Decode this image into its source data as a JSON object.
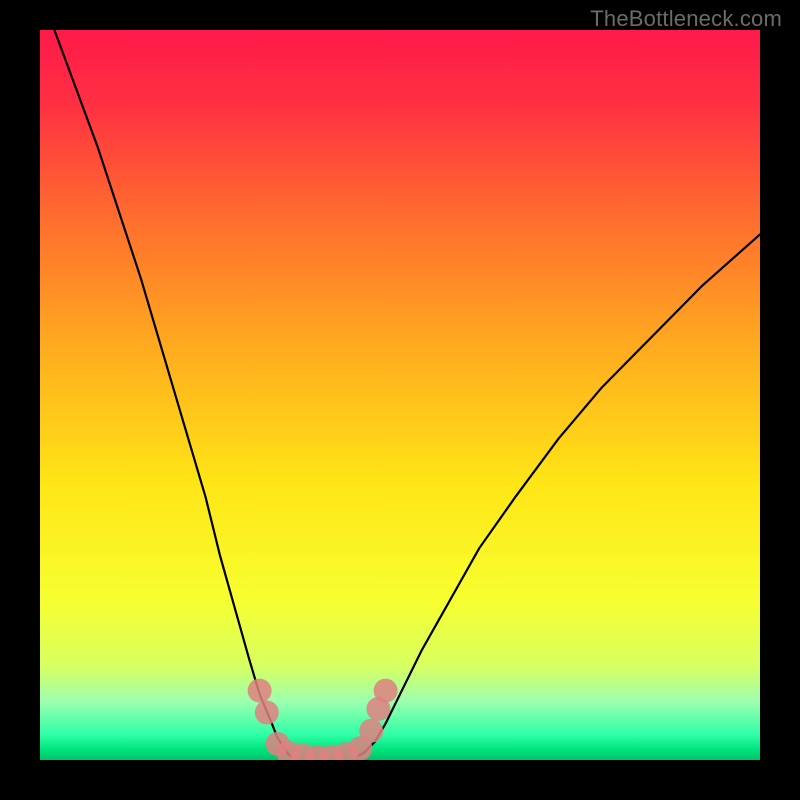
{
  "watermark": "TheBottleneck.com",
  "chart_data": {
    "type": "line",
    "title": "",
    "xlabel": "",
    "ylabel": "",
    "xlim": [
      0,
      100
    ],
    "ylim": [
      0,
      100
    ],
    "grid": false,
    "legend": false,
    "gradient_stops": [
      {
        "offset": 0.0,
        "color": "#ff1a4b"
      },
      {
        "offset": 0.1,
        "color": "#ff2f42"
      },
      {
        "offset": 0.25,
        "color": "#ff6a2f"
      },
      {
        "offset": 0.45,
        "color": "#ffb01e"
      },
      {
        "offset": 0.62,
        "color": "#ffe516"
      },
      {
        "offset": 0.78,
        "color": "#f7ff30"
      },
      {
        "offset": 0.87,
        "color": "#d8ff60"
      },
      {
        "offset": 0.92,
        "color": "#9cffb0"
      },
      {
        "offset": 0.965,
        "color": "#30ffa8"
      },
      {
        "offset": 0.985,
        "color": "#00e580"
      },
      {
        "offset": 1.0,
        "color": "#00c46a"
      }
    ],
    "series": [
      {
        "name": "left-curve",
        "color": "#000000",
        "x": [
          2,
          5,
          8,
          11,
          14,
          17,
          20,
          23,
          25,
          27,
          29,
          30.5,
          32,
          33,
          34,
          34.5,
          35
        ],
        "y": [
          100,
          92,
          84,
          75,
          66,
          56,
          46,
          36,
          28,
          21,
          14,
          9,
          5.5,
          3,
          1.5,
          0.8,
          0.5
        ]
      },
      {
        "name": "right-curve",
        "color": "#000000",
        "x": [
          44,
          45,
          46.5,
          48,
          50,
          53,
          57,
          61,
          66,
          72,
          78,
          85,
          92,
          100
        ],
        "y": [
          0.5,
          1,
          2.5,
          5,
          9,
          15,
          22,
          29,
          36,
          44,
          51,
          58,
          65,
          72
        ]
      },
      {
        "name": "green-floor",
        "color": "#00c46a",
        "x": [
          0,
          100
        ],
        "y": [
          0,
          0
        ]
      }
    ],
    "scatter": {
      "name": "bottleneck-markers",
      "color": "#e08080",
      "radius": 12,
      "points": [
        {
          "x": 30.5,
          "y": 9.5
        },
        {
          "x": 31.5,
          "y": 6.5
        },
        {
          "x": 33,
          "y": 2.2
        },
        {
          "x": 34.5,
          "y": 1.0
        },
        {
          "x": 36.5,
          "y": 0.6
        },
        {
          "x": 38.5,
          "y": 0.4
        },
        {
          "x": 40.5,
          "y": 0.4
        },
        {
          "x": 42.5,
          "y": 0.8
        },
        {
          "x": 44.5,
          "y": 1.6
        },
        {
          "x": 46,
          "y": 4.0
        },
        {
          "x": 47,
          "y": 7.0
        },
        {
          "x": 48,
          "y": 9.5
        }
      ]
    }
  }
}
